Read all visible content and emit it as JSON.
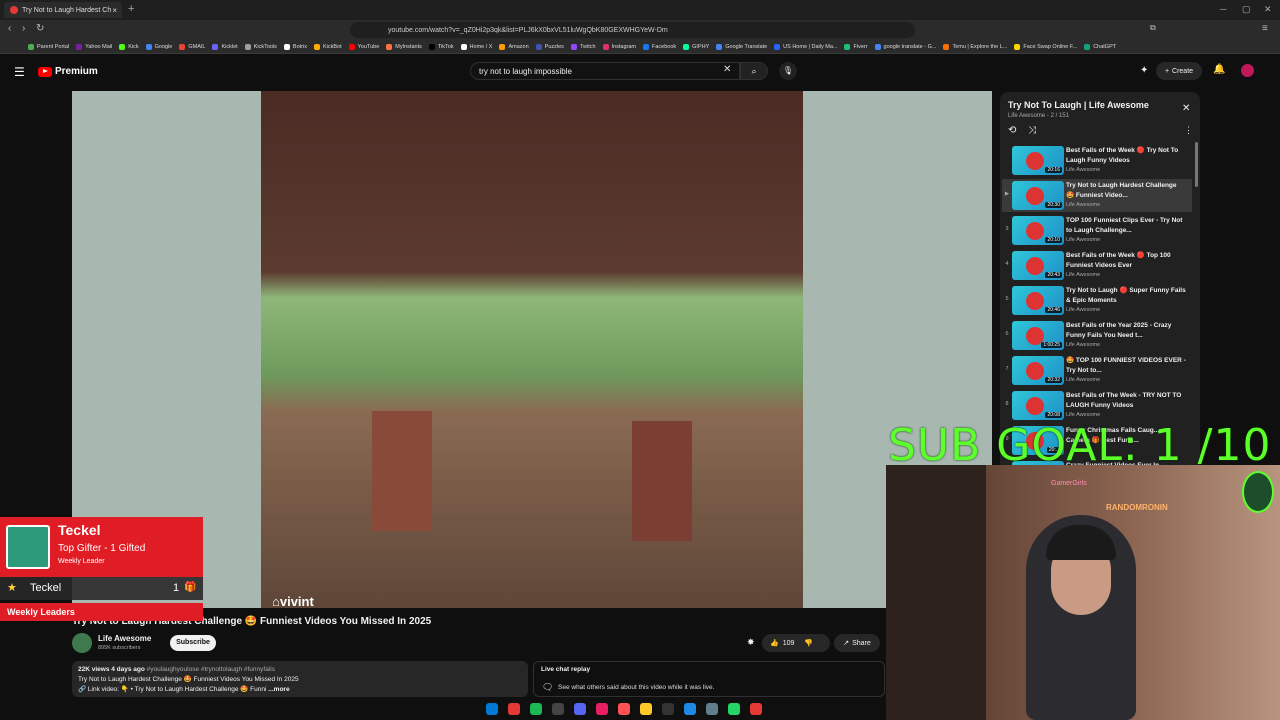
{
  "browser": {
    "tab_title": "Try Not to Laugh Hardest Ch",
    "tab_close": "×",
    "new_tab": "+",
    "url": "youtube.com/watch?v=_qZ0Hi2p3qk&list=PLJ6kX0bxVL51luWgQbK80GEXWHGYeW-Dm",
    "bookmarks": [
      "Parent Portal",
      "Yahoo Mail",
      "Kick",
      "Google",
      "GMAIL",
      "Kicklet",
      "KickTools",
      "Botrix",
      "KickBot",
      "YouTube",
      "MyInstants",
      "TikTok",
      "Home / X",
      "Amazon",
      "Puzzles",
      "Twitch",
      "Instagram",
      "Facebook",
      "GIPHY",
      "Google Translate",
      "US Home | Daily Ma...",
      "Fiverr",
      "google translate - G...",
      "Temu | Explore the L...",
      "Face Swap Online F...",
      "ChatGPT"
    ],
    "bookmark_colors": [
      "#4caf50",
      "#7b1fa2",
      "#53fc18",
      "#4285f4",
      "#ea4335",
      "#6c63ff",
      "#9e9e9e",
      "#ffffff",
      "#ffab00",
      "#ff0000",
      "#ff7043",
      "#000000",
      "#ffffff",
      "#ff9900",
      "#3f51b5",
      "#9146ff",
      "#e1306c",
      "#1877f2",
      "#00ff99",
      "#4285f4",
      "#2962ff",
      "#1dbf73",
      "#4285f4",
      "#ff6f00",
      "#ffd600",
      "#10a37f"
    ]
  },
  "youtube": {
    "brand": "Premium",
    "search_query": "try not to laugh impossible",
    "create_label": "Create"
  },
  "video": {
    "watermark": "vivint",
    "title": "Try Not to Laugh Hardest Challenge 🤩 Funniest Videos You Missed In 2025",
    "channel": "Life Awesome",
    "subscribers": "895K subscribers",
    "subscribe_label": "Subscribe",
    "likes": "109",
    "share_label": "Share",
    "desc_meta": "22K views  4 days ago",
    "desc_tags": "#youlaughyoulose #trynottolaugh #funnyfails",
    "desc_line2": "Try Not to Laugh Hardest Challenge 🤩 Funniest Videos You Missed In 2025",
    "desc_line3": "🔗 Link video: 👇 • Try Not to Laugh Hardest Challenge 🤩 Funni",
    "more_label": "...more",
    "live_chat_title": "Live chat replay",
    "live_chat_sub": "See what others said about this video while it was live."
  },
  "playlist": {
    "title": "Try Not To Laugh | Life Awesome",
    "subtitle": "Life Awesome - 2 / 151",
    "items": [
      {
        "index": "",
        "title": "Best Fails of the Week 🔴 Try Not To Laugh Funny Videos",
        "channel": "Life Awesome",
        "duration": "20:16"
      },
      {
        "index": "▶",
        "title": "Try Not to Laugh Hardest Challenge 🤩 Funniest Video...",
        "channel": "Life Awesome",
        "duration": "20:30"
      },
      {
        "index": "3",
        "title": "TOP 100 Funniest Clips Ever - Try Not to Laugh Challenge...",
        "channel": "Life Awesome",
        "duration": "20:10"
      },
      {
        "index": "4",
        "title": "Best Fails of the Week 🔴 Top 100 Funniest Videos Ever",
        "channel": "Life Awesome",
        "duration": "20:43"
      },
      {
        "index": "5",
        "title": "Try Not to Laugh 🔴 Super Funny Fails & Epic Moments",
        "channel": "Life Awesome",
        "duration": "20:46"
      },
      {
        "index": "6",
        "title": "Best Fails of the Year 2025 - Crazy Funny Fails You Need t...",
        "channel": "Life Awesome",
        "duration": "1:00:25"
      },
      {
        "index": "7",
        "title": "🤩 TOP 100 FUNNIEST VIDEOS EVER - Try Not to...",
        "channel": "Life Awesome",
        "duration": "20:32"
      },
      {
        "index": "8",
        "title": "Best Fails of The Week - TRY NOT TO LAUGH Funny Videos",
        "channel": "Life Awesome",
        "duration": "20:08"
      },
      {
        "index": "9",
        "title": "Funny Christmas Fails Caug... on Camera 🎁 Best Funn...",
        "channel": "",
        "duration": "20:..."
      },
      {
        "index": "",
        "title": "Crazy Funniest Videos Ever In",
        "channel": "",
        "duration": ""
      }
    ]
  },
  "overlay": {
    "sub_goal": "SUB GOAL: 1  /10",
    "gifter_name": "Teckel",
    "gifter_role": "Top Gifter - 1 Gifted",
    "gifter_tag": "Weekly Leader",
    "leader_name": "Teckel",
    "leader_count": "1",
    "weekly_leaders": "Weekly Leaders",
    "cam_text_1": "RANDOMRONIN",
    "cam_text_2": "GamerGirls"
  },
  "taskbar_colors": [
    "#0078d4",
    "#e53935",
    "#1db954",
    "#444444",
    "#5865f2",
    "#e91e63",
    "#ff5252",
    "#ffca28",
    "#333333",
    "#1e88e5",
    "#607d8b",
    "#25d366",
    "#e53935"
  ]
}
